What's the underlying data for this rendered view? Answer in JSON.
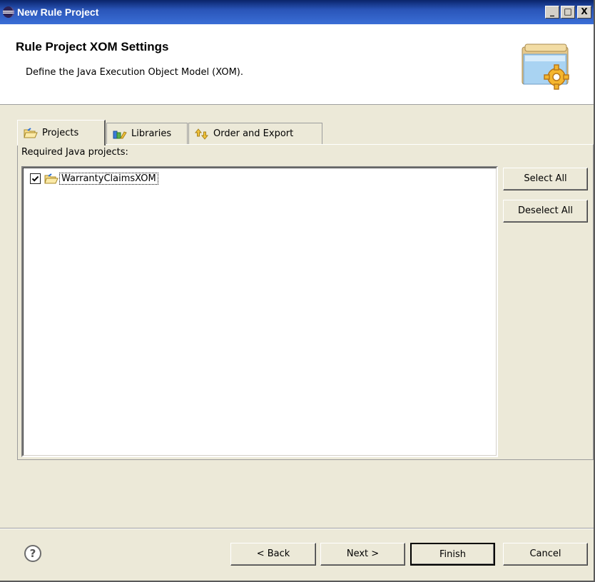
{
  "window": {
    "title": "New Rule Project",
    "controls": {
      "minimize": "_",
      "maximize": "□",
      "close": "X"
    }
  },
  "header": {
    "title": "Rule Project XOM Settings",
    "description": "Define the Java Execution Object Model (XOM)."
  },
  "tabs": [
    {
      "label": "Projects",
      "icon": "folder-open-icon",
      "active": true
    },
    {
      "label": "Libraries",
      "icon": "library-books-icon",
      "active": false
    },
    {
      "label": "Order and Export",
      "icon": "order-arrows-icon",
      "active": false
    }
  ],
  "projects_tab": {
    "required_label": "Required Java projects:",
    "items": [
      {
        "label": "WarrantyClaimsXOM",
        "checked": true,
        "icon": "project-folder-icon"
      }
    ],
    "select_all": "Select All",
    "deselect_all": "Deselect All"
  },
  "footer": {
    "help_icon": "help-icon",
    "back": "< Back",
    "next": "Next >",
    "finish": "Finish",
    "cancel": "Cancel"
  },
  "colors": {
    "titlebar": "#0a246a",
    "dialog_bg": "#ece9d8",
    "list_bg": "#ffffff"
  }
}
